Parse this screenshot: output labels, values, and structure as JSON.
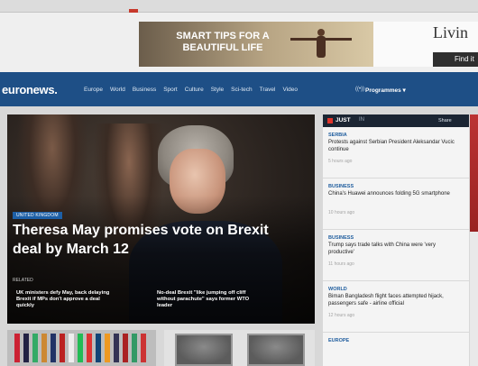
{
  "ad": {
    "left_text": "SMART TIPS FOR A BEAUTIFUL LIFE",
    "right_brand": "Livin",
    "right_cta": "Find it"
  },
  "nav": {
    "logo": "euronews.",
    "items": [
      "Europe",
      "World",
      "Business",
      "Sport",
      "Culture",
      "Style",
      "Sci-tech",
      "Travel",
      "Video"
    ],
    "live": "((•))",
    "programmes": "Programmes ▾"
  },
  "hero": {
    "badge": "UNITED KINGDOM",
    "headline": "Theresa May promises vote on Brexit deal by March 12",
    "related_label": "RELATED",
    "related": [
      "UK ministers defy May, back delaying Brexit if MPs don't approve a deal quickly",
      "No-deal Brexit \"like jumping off cliff without parachute\" says former WTO leader"
    ]
  },
  "just_in": {
    "label": "JUST",
    "label_suffix": "IN",
    "share": "Share",
    "items": [
      {
        "category": "SERBIA",
        "title": "Protests against Serbian President Aleksandar Vucic continue",
        "time": "5 hours ago"
      },
      {
        "category": "BUSINESS",
        "title": "China's Huawei announces folding 5G smartphone",
        "time": "10 hours ago"
      },
      {
        "category": "BUSINESS",
        "title": "Trump says trade talks with China were 'very productive'",
        "time": "11 hours ago"
      },
      {
        "category": "WORLD",
        "title": "Biman Bangladesh flight faces attempted hijack, passengers safe - airline official",
        "time": "12 hours ago"
      },
      {
        "category": "EUROPE",
        "title": "",
        "time": ""
      }
    ]
  },
  "colors": {
    "nav_bg": "#1e4f86",
    "accent_red": "#e0342b",
    "category_blue": "#1f5d9e"
  }
}
